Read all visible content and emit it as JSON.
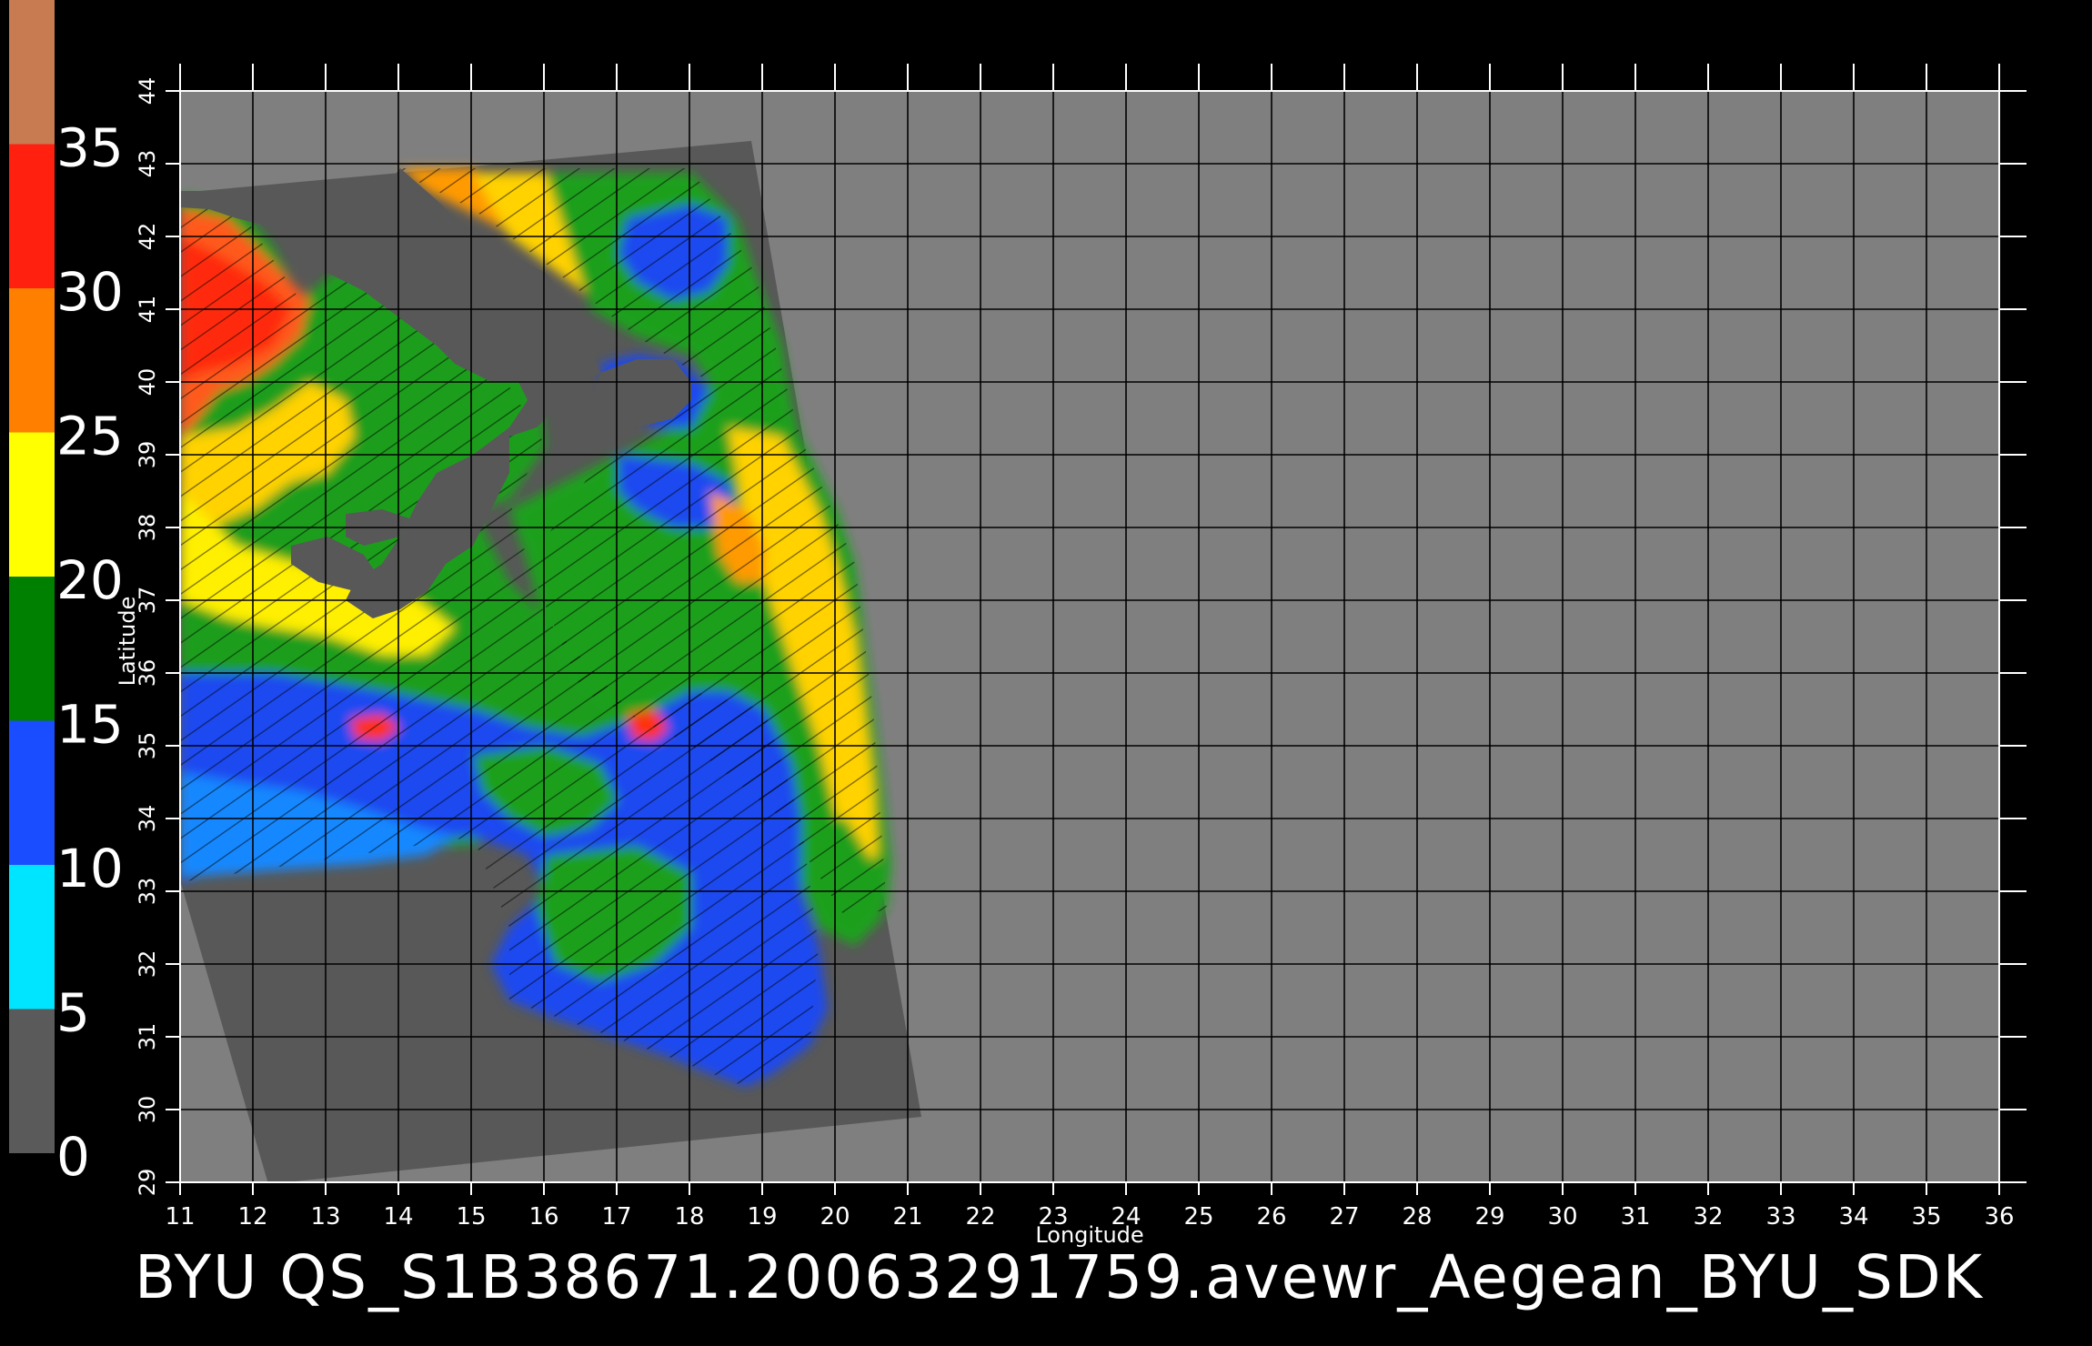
{
  "colorbar": {
    "ticks": [
      "0",
      "5",
      "10",
      "15",
      "20",
      "25",
      "30",
      "35"
    ],
    "bands": [
      "#5a5a5a",
      "#00e5ff",
      "#1a4dff",
      "#008000",
      "#ffff00",
      "#ff8000",
      "#ff2010",
      "#c87a50"
    ]
  },
  "map": {
    "background": "#7f7f7f",
    "swath_fill": "#585858",
    "x_axis_label": "Longitude",
    "y_axis_label": "Latitude",
    "lon_ticks": [
      "11",
      "12",
      "13",
      "14",
      "15",
      "16",
      "17",
      "18",
      "19",
      "20",
      "21",
      "22",
      "23",
      "24",
      "25",
      "26",
      "27",
      "28",
      "29",
      "30",
      "31",
      "32",
      "33",
      "34",
      "35",
      "36"
    ],
    "lat_ticks": [
      "29",
      "30",
      "31",
      "32",
      "33",
      "34",
      "35",
      "36",
      "37",
      "38",
      "39",
      "40",
      "41",
      "42",
      "43",
      "44"
    ]
  },
  "title": "BYU  QS_S1B38671.20063291759.avewr_Aegean_BYU_SDK"
}
